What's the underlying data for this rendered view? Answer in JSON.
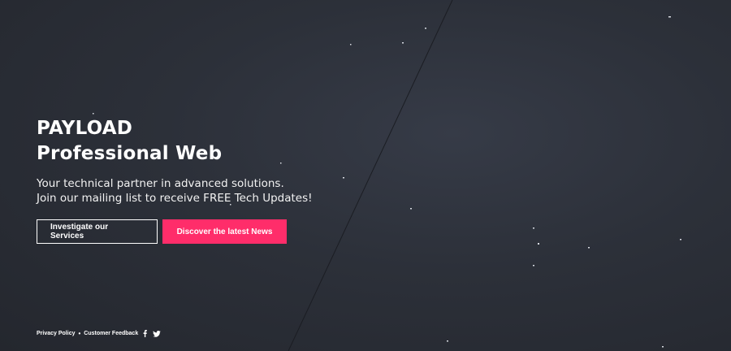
{
  "hero": {
    "title_line1": "PAYLOAD",
    "title_line2": "Professional Web",
    "subtitle_line1": "Your technical partner in advanced solutions.",
    "subtitle_line2": "Join our mailing list to receive FREE Tech Updates!"
  },
  "actions": {
    "services_label": "Investigate our Services",
    "news_label": "Discover the latest News"
  },
  "footer": {
    "privacy_label": "Privacy Policy",
    "separator": "•",
    "feedback_label": "Customer Feedback",
    "social_icons": [
      "facebook-icon",
      "twitter-icon"
    ]
  },
  "colors": {
    "accent": "#ff2d6a",
    "background": "#2c3039"
  }
}
